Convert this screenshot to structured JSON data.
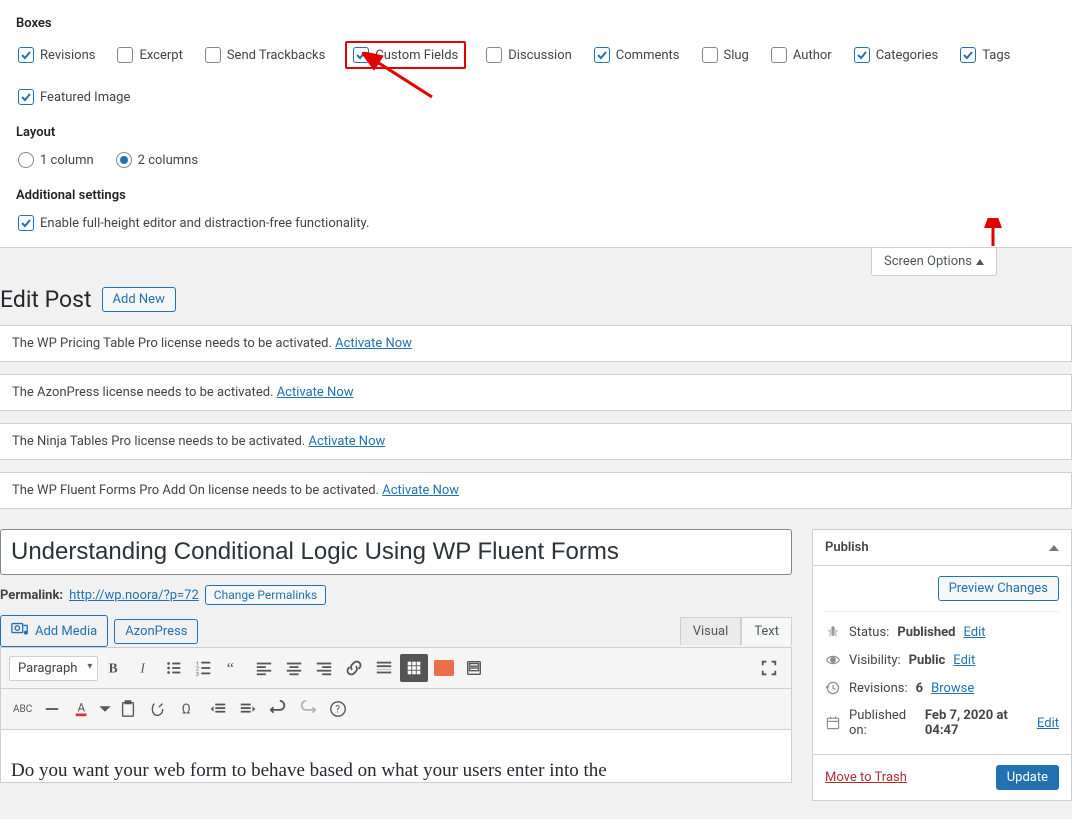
{
  "screen_options": {
    "boxes_heading": "Boxes",
    "boxes": [
      {
        "label": "Revisions",
        "checked": true,
        "name": "revisions"
      },
      {
        "label": "Excerpt",
        "checked": false,
        "name": "excerpt"
      },
      {
        "label": "Send Trackbacks",
        "checked": false,
        "name": "trackbacks"
      },
      {
        "label": "Custom Fields",
        "checked": true,
        "name": "custom-fields",
        "highlighted": true
      },
      {
        "label": "Discussion",
        "checked": false,
        "name": "discussion"
      },
      {
        "label": "Comments",
        "checked": true,
        "name": "comments"
      },
      {
        "label": "Slug",
        "checked": false,
        "name": "slug"
      },
      {
        "label": "Author",
        "checked": false,
        "name": "author"
      },
      {
        "label": "Categories",
        "checked": true,
        "name": "categories"
      },
      {
        "label": "Tags",
        "checked": true,
        "name": "tags"
      },
      {
        "label": "Featured Image",
        "checked": true,
        "name": "featured-image"
      }
    ],
    "layout_heading": "Layout",
    "layout_options": [
      {
        "label": "1 column",
        "checked": false,
        "name": "1col"
      },
      {
        "label": "2 columns",
        "checked": true,
        "name": "2col"
      }
    ],
    "additional_heading": "Additional settings",
    "additional": [
      {
        "label": "Enable full-height editor and distraction-free functionality.",
        "checked": true,
        "name": "fullheight"
      }
    ],
    "tab_label": "Screen Options"
  },
  "page": {
    "heading": "Edit Post",
    "add_new": "Add New"
  },
  "notices": [
    {
      "text": "The WP Pricing Table Pro license needs to be activated. ",
      "link": "Activate Now"
    },
    {
      "text": "The AzonPress license needs to be activated. ",
      "link": "Activate Now"
    },
    {
      "text": "The Ninja Tables Pro license needs to be activated. ",
      "link": "Activate Now"
    },
    {
      "text": "The WP Fluent Forms Pro Add On license needs to be activated. ",
      "link": "Activate Now"
    }
  ],
  "post": {
    "title": "Understanding Conditional Logic Using WP Fluent Forms",
    "permalink_label": "Permalink:",
    "permalink": "http://wp.noora/?p=72",
    "change_permalinks": "Change Permalinks",
    "content_preview": "Do you want your web form to behave based on what your users enter into the"
  },
  "media_buttons": {
    "add_media": "Add Media",
    "azonpress": "AzonPress"
  },
  "editor_tabs": {
    "visual": "Visual",
    "text": "Text"
  },
  "tinymce": {
    "format": "Paragraph"
  },
  "publish": {
    "title": "Publish",
    "preview": "Preview Changes",
    "status_label": "Status:",
    "status_value": "Published",
    "visibility_label": "Visibility:",
    "visibility_value": "Public",
    "revisions_label": "Revisions:",
    "revisions_value": "6",
    "browse": "Browse",
    "published_label": "Published on:",
    "published_value": "Feb 7, 2020 at 04:47",
    "edit": "Edit",
    "trash": "Move to Trash",
    "update": "Update"
  }
}
